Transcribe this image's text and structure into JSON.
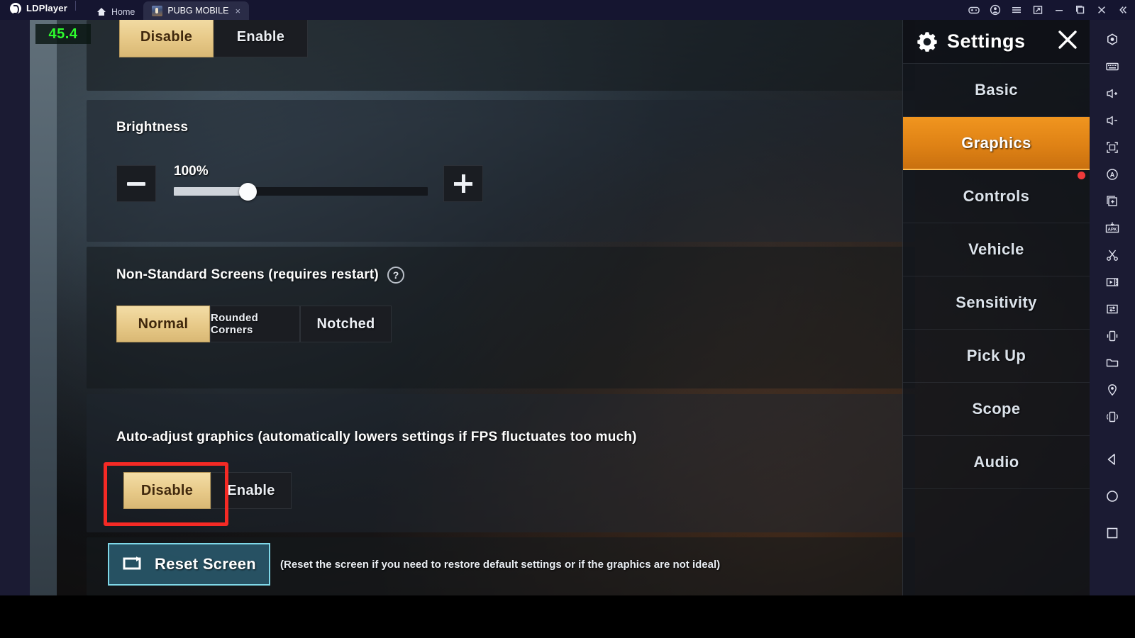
{
  "titlebar": {
    "brand": "LDPlayer",
    "tabs": [
      {
        "label": "Home",
        "icon": "home-icon",
        "active": false
      },
      {
        "label": "PUBG MOBILE",
        "icon": "app-thumbnail",
        "active": true,
        "close": "×"
      }
    ],
    "window_controls": [
      {
        "name": "gamepad-icon"
      },
      {
        "name": "account-icon"
      },
      {
        "name": "menu-icon"
      },
      {
        "name": "multi-instance-icon"
      },
      {
        "name": "minimize-icon"
      },
      {
        "name": "maximize-icon"
      },
      {
        "name": "close-icon"
      },
      {
        "name": "collapse-icon"
      }
    ]
  },
  "overlay": {
    "fps": "45.4"
  },
  "graphics": {
    "top_toggle": {
      "options": [
        "Disable",
        "Enable"
      ],
      "selected": "Disable"
    },
    "brightness": {
      "label": "Brightness",
      "value_text": "100%",
      "value": 100,
      "slider_percent": 29,
      "decrease": "−",
      "increase": "+"
    },
    "non_standard": {
      "label": "Non-Standard Screens (requires restart)",
      "help": "?",
      "options": [
        "Normal",
        "Rounded Corners",
        "Notched"
      ],
      "selected": "Normal"
    },
    "auto_adjust": {
      "label": "Auto-adjust graphics (automatically lowers settings if FPS fluctuates too much)",
      "options": [
        "Disable",
        "Enable"
      ],
      "selected": "Disable",
      "highlight_color": "#f52a25"
    },
    "reset": {
      "button_label": "Reset Screen",
      "note": "(Reset the screen if you need to restore default settings or if the graphics are not ideal)",
      "icon": "reset-screen-icon"
    }
  },
  "settings_panel": {
    "title": "Settings",
    "gear_icon": "gear-icon",
    "close_icon": "close-icon",
    "items": [
      {
        "label": "Basic",
        "active": false,
        "badge": false
      },
      {
        "label": "Graphics",
        "active": true,
        "badge": false
      },
      {
        "label": "Controls",
        "active": false,
        "badge": true
      },
      {
        "label": "Vehicle",
        "active": false,
        "badge": false
      },
      {
        "label": "Sensitivity",
        "active": false,
        "badge": false
      },
      {
        "label": "Pick Up",
        "active": false,
        "badge": false
      },
      {
        "label": "Scope",
        "active": false,
        "badge": false
      },
      {
        "label": "Audio",
        "active": false,
        "badge": false
      }
    ],
    "accent_color": "#e08214"
  },
  "sidebar_toolbar": {
    "items": [
      {
        "name": "settings-gear-icon"
      },
      {
        "name": "keyboard-icon"
      },
      {
        "name": "volume-up-icon"
      },
      {
        "name": "volume-down-icon"
      },
      {
        "name": "fullscreen-icon"
      },
      {
        "name": "auto-rotate-icon"
      },
      {
        "name": "multi-instance-icon"
      },
      {
        "name": "apk-install-icon"
      },
      {
        "name": "screenshot-scissors-icon"
      },
      {
        "name": "video-record-icon"
      },
      {
        "name": "sync-operation-icon"
      },
      {
        "name": "shake-icon"
      },
      {
        "name": "folder-icon"
      },
      {
        "name": "location-icon"
      },
      {
        "name": "virtual-phone-icon"
      }
    ],
    "nav_items": [
      {
        "name": "back-triangle-icon"
      },
      {
        "name": "home-circle-icon"
      },
      {
        "name": "recents-square-icon"
      }
    ]
  }
}
